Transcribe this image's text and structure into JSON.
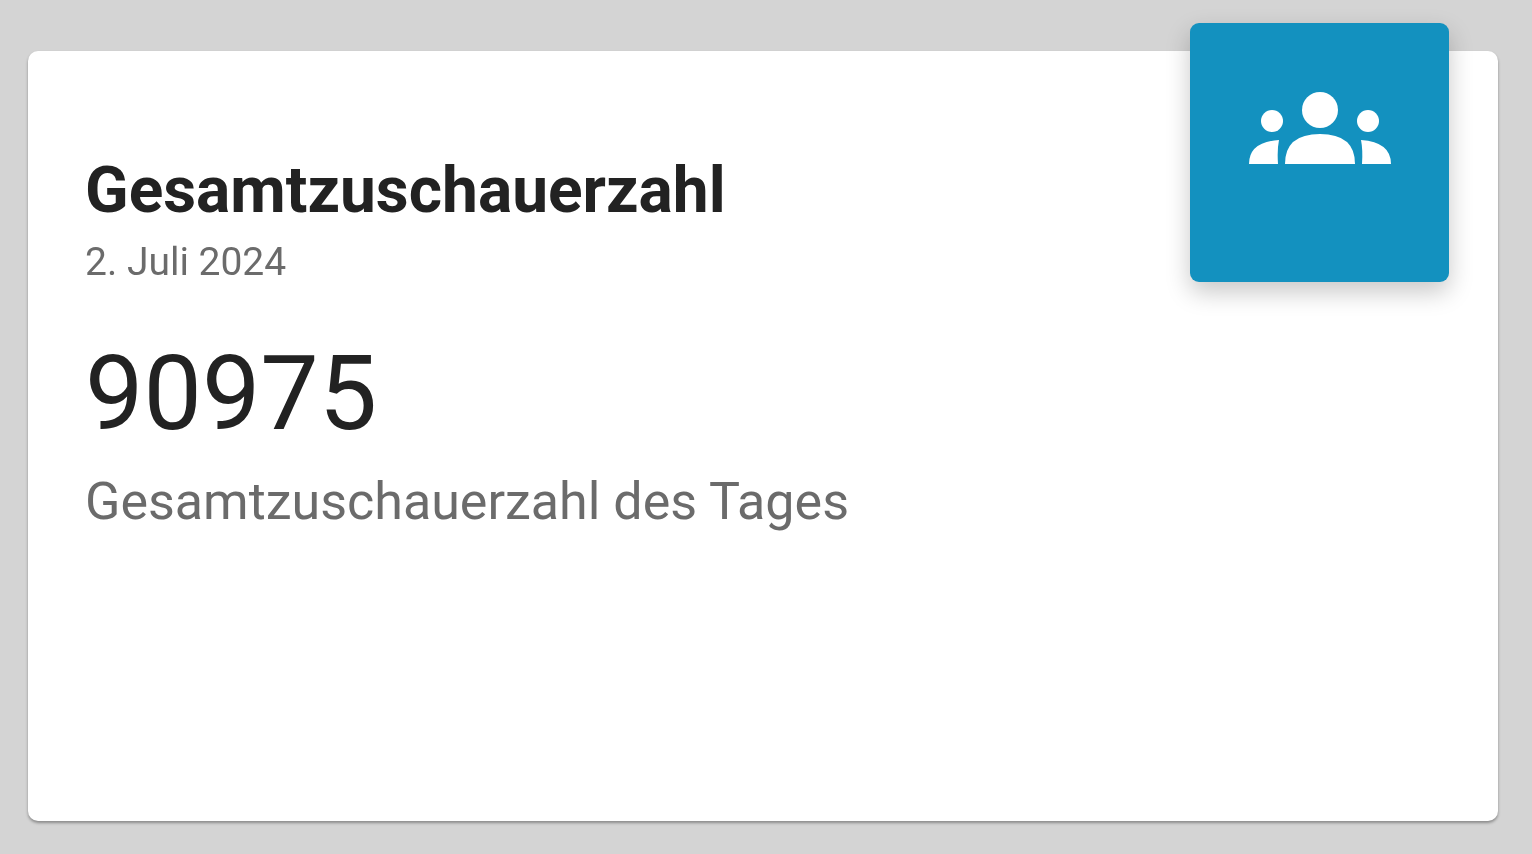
{
  "card": {
    "title": "Gesamtzuschauerzahl",
    "date": "2. Juli 2024",
    "value": "90975",
    "caption": "Gesamtzuschauerzahl des Tages"
  }
}
